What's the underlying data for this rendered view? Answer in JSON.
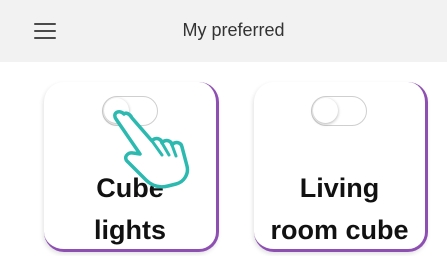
{
  "header": {
    "title": "My preferred",
    "menu_icon": "hamburger-menu-icon"
  },
  "cards": [
    {
      "label": "Cube\nlights",
      "toggle_on": false
    },
    {
      "label": "Living\nroom cube",
      "toggle_on": false
    }
  ],
  "colors": {
    "app_bar": "#f2f2f2",
    "card_accent": "#8e4fb3",
    "hand_pointer": "#2bb9b0"
  },
  "overlay": {
    "icon": "tap-hand-pointer-icon"
  }
}
